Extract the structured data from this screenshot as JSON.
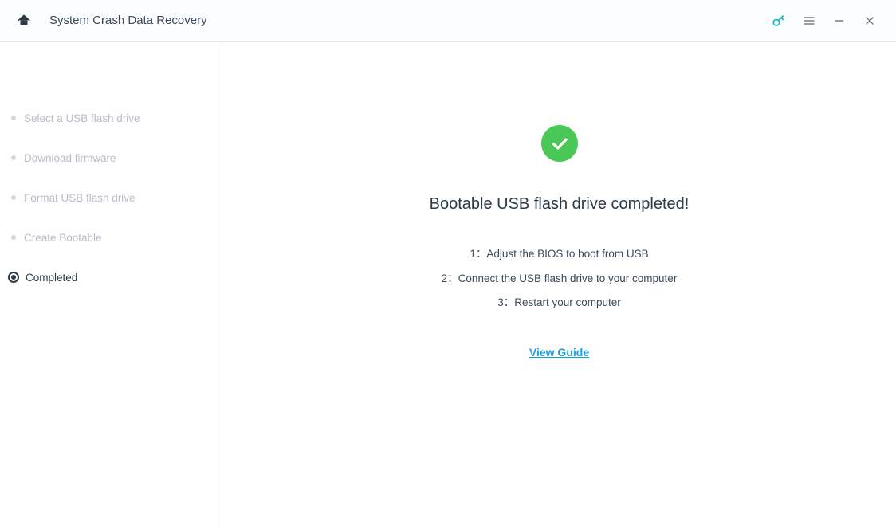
{
  "header": {
    "title": "System Crash Data Recovery"
  },
  "sidebar": {
    "steps": [
      {
        "label": "Select a USB flash drive"
      },
      {
        "label": "Download firmware"
      },
      {
        "label": "Format USB flash drive"
      },
      {
        "label": "Create Bootable"
      },
      {
        "label": "Completed"
      }
    ],
    "active_index": 4
  },
  "main": {
    "heading": "Bootable USB flash drive completed!",
    "instructions": [
      "1：Adjust the BIOS to boot from USB",
      "2：Connect the USB flash drive to your computer",
      "3：Restart your computer"
    ],
    "view_guide_label": "View Guide"
  },
  "colors": {
    "accent_green": "#49c757",
    "link_blue": "#1a9de2",
    "key_teal": "#0fb7c6"
  }
}
